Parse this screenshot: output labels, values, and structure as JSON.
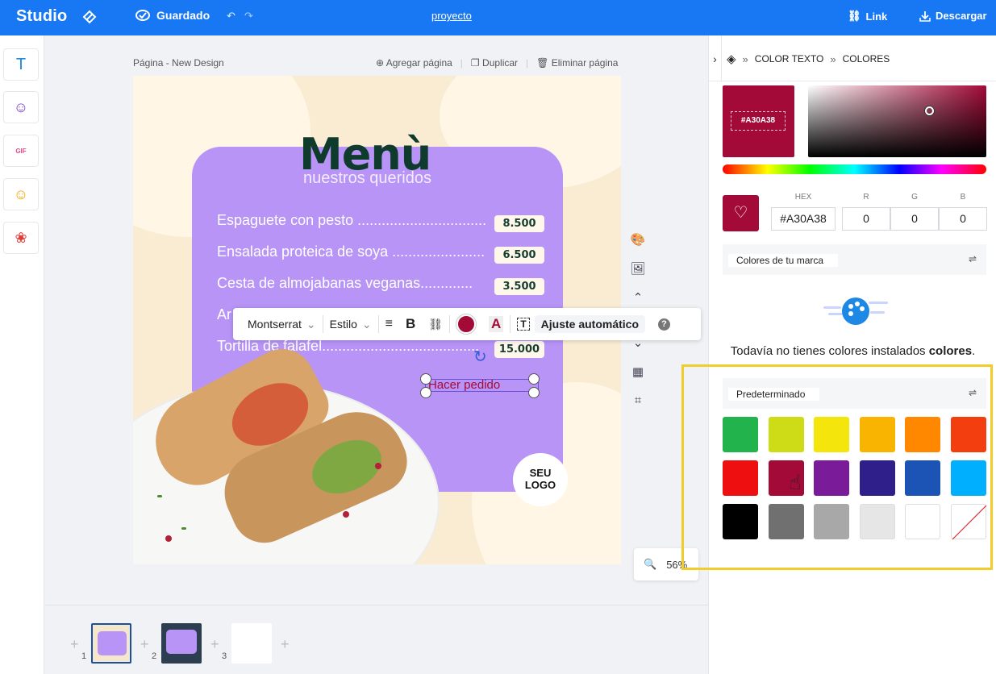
{
  "topbar": {
    "brand": "Studio",
    "saved_label": "Guardado",
    "project_link": "proyecto",
    "link_label": "Link",
    "download_label": "Descargar",
    "colors": {
      "bar": "#1877f2"
    }
  },
  "rail": {
    "tools": [
      {
        "icon": "text-icon",
        "glyph": "T"
      },
      {
        "icon": "sticker-icon",
        "glyph": "☺"
      },
      {
        "icon": "gif-icon",
        "glyph": "GIF"
      },
      {
        "icon": "emoji-icon",
        "glyph": "☺"
      },
      {
        "icon": "shapes-icon",
        "glyph": "❀"
      }
    ]
  },
  "canvas": {
    "page_label": "Página - New Design",
    "actions": {
      "add": "Agregar página",
      "duplicate": "Duplicar",
      "delete": "Eliminar página"
    },
    "zoom": "56%"
  },
  "design": {
    "title": "Menù",
    "subtitle": "nuestros queridos",
    "items": [
      {
        "name": "Espaguete con pesto .................................",
        "price": "8.500"
      },
      {
        "name": "Ensalada proteica de soya .......................",
        "price": "6.500"
      },
      {
        "name": "Cesta de almojabanas veganas.............",
        "price": "3.500"
      },
      {
        "name": "Ar",
        "price": ""
      },
      {
        "name": "Tortilla de falafel.......................................",
        "price": "15.000"
      }
    ],
    "order_text": "Hacer pedido",
    "logo_line1": "SEU",
    "logo_line2": "LOGO"
  },
  "toolbar": {
    "font": "Montserrat",
    "style": "Estilo",
    "auto_fit": "Ajuste automático",
    "color": "#a30a38"
  },
  "filmstrip": {
    "pages": [
      "1",
      "2",
      "3"
    ]
  },
  "panel": {
    "crumb1": "COLOR TEXTO",
    "crumb2": "COLORES",
    "current_hex_label": "#A30A38",
    "hex_label": "HEX",
    "r_label": "R",
    "g_label": "G",
    "b_label": "B",
    "hex_value": "#A30A38",
    "r_value": "0",
    "g_value": "0",
    "b_value": "0",
    "brand_colors": "Colores de tu marca",
    "empty_prefix": "Todavía no tienes colores instalados ",
    "empty_bold": "colores",
    "empty_suffix": ".",
    "defaults": "Predeterminado",
    "swatches": [
      "#22b34c",
      "#cddc16",
      "#f4e60c",
      "#f8b400",
      "#ff8800",
      "#f33e10",
      "#ee1010",
      "#a30a38",
      "#7a1c9a",
      "#2e1f8a",
      "#1b54b5",
      "#00b0ff",
      "#000000",
      "#707070",
      "#a8a8a8",
      "#e6e6e6",
      "#ffffff",
      "none"
    ]
  }
}
